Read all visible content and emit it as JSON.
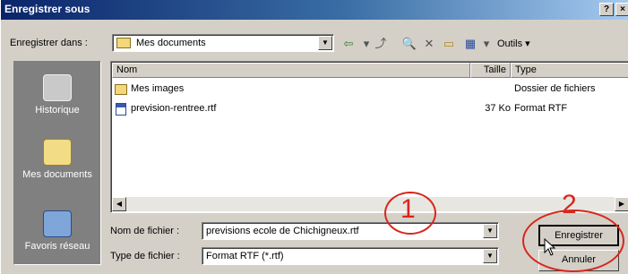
{
  "window": {
    "title": "Enregistrer sous",
    "help_label": "?",
    "close_label": "×"
  },
  "toolbar": {
    "save_in_label": "Enregistrer dans :",
    "current_folder": "Mes documents",
    "tools_label": "Outils ▾"
  },
  "places": {
    "items": [
      {
        "label": "Historique"
      },
      {
        "label": "Mes documents"
      },
      {
        "label": "Favoris réseau"
      }
    ]
  },
  "filelist": {
    "columns": {
      "name": "Nom",
      "size": "Taille",
      "type": "Type"
    },
    "rows": [
      {
        "name": "Mes images",
        "size": "",
        "type": "Dossier de fichiers"
      },
      {
        "name": "prevision-rentree.rtf",
        "size": "37 Ko",
        "type": "Format RTF"
      }
    ]
  },
  "form": {
    "filename_label": "Nom de fichier :",
    "filename_value": "previsions ecole de Chichigneux.rtf",
    "filetype_label": "Type de fichier :",
    "filetype_value": "Format RTF (*.rtf)"
  },
  "buttons": {
    "save": "Enregistrer",
    "cancel": "Annuler"
  },
  "annotations": {
    "step1": "1",
    "step2": "2",
    "color": "#d8261c"
  }
}
